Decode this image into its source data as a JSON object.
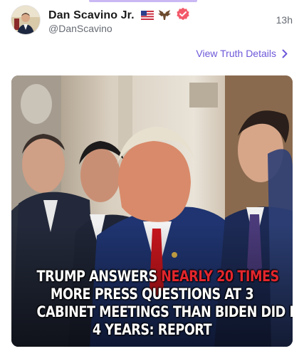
{
  "post": {
    "author_name": "Dan Scavino Jr.",
    "author_handle": "@DanScavino",
    "timestamp": "13h",
    "details_link": "View Truth Details"
  },
  "media": {
    "headline": {
      "line1_prefix": "TRUMP ANSWERS ",
      "line1_highlight": "NEARLY 20 TIMES",
      "line2": "MORE PRESS QUESTIONS AT 3",
      "line3": "CABINET MEETINGS THAN BIDEN DID IN",
      "line4": "4 YEARS: REPORT"
    }
  },
  "icons": {
    "flag": "us-flag-icon",
    "eagle": "eagle-icon",
    "verified": "verified-badge-icon",
    "chevron": "chevron-right-icon"
  },
  "colors": {
    "accent": "#6e58d9",
    "verified": "#f25a6a",
    "headline_highlight": "#e2262d"
  }
}
